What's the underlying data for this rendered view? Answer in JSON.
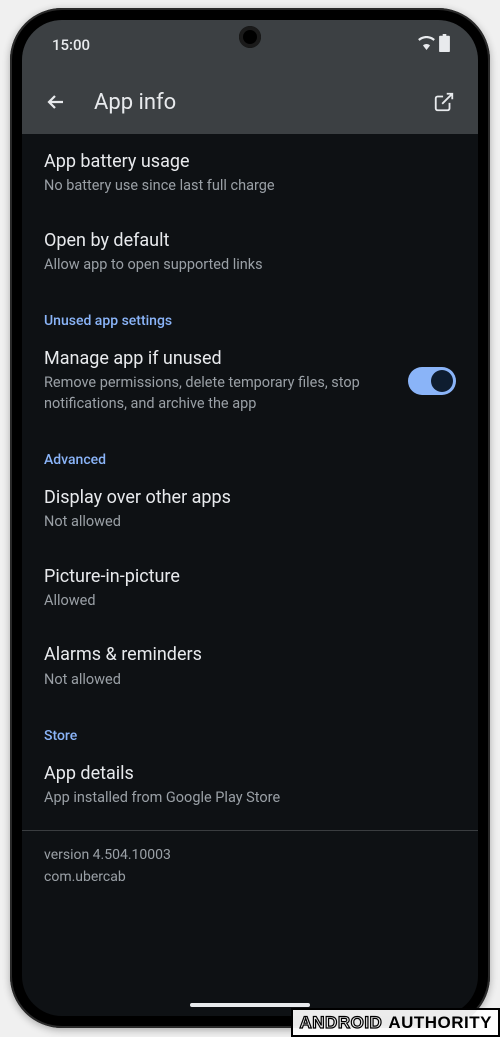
{
  "status": {
    "time": "15:00"
  },
  "header": {
    "title": "App info"
  },
  "items": {
    "battery": {
      "title": "App battery usage",
      "sub": "No battery use since last full charge"
    },
    "openDefault": {
      "title": "Open by default",
      "sub": "Allow app to open supported links"
    }
  },
  "sections": {
    "unused": {
      "header": "Unused app settings",
      "manage": {
        "title": "Manage app if unused",
        "sub": "Remove permissions, delete temporary files, stop notifications, and archive the app"
      }
    },
    "advanced": {
      "header": "Advanced",
      "overlay": {
        "title": "Display over other apps",
        "sub": "Not allowed"
      },
      "pip": {
        "title": "Picture-in-picture",
        "sub": "Allowed"
      },
      "alarms": {
        "title": "Alarms & reminders",
        "sub": "Not allowed"
      }
    },
    "store": {
      "header": "Store",
      "details": {
        "title": "App details",
        "sub": "App installed from Google Play Store"
      }
    }
  },
  "footer": {
    "version": "version 4.504.10003",
    "package": "com.ubercab"
  },
  "watermark": {
    "a": "ANDROID",
    "b": "AUTHORITY"
  }
}
